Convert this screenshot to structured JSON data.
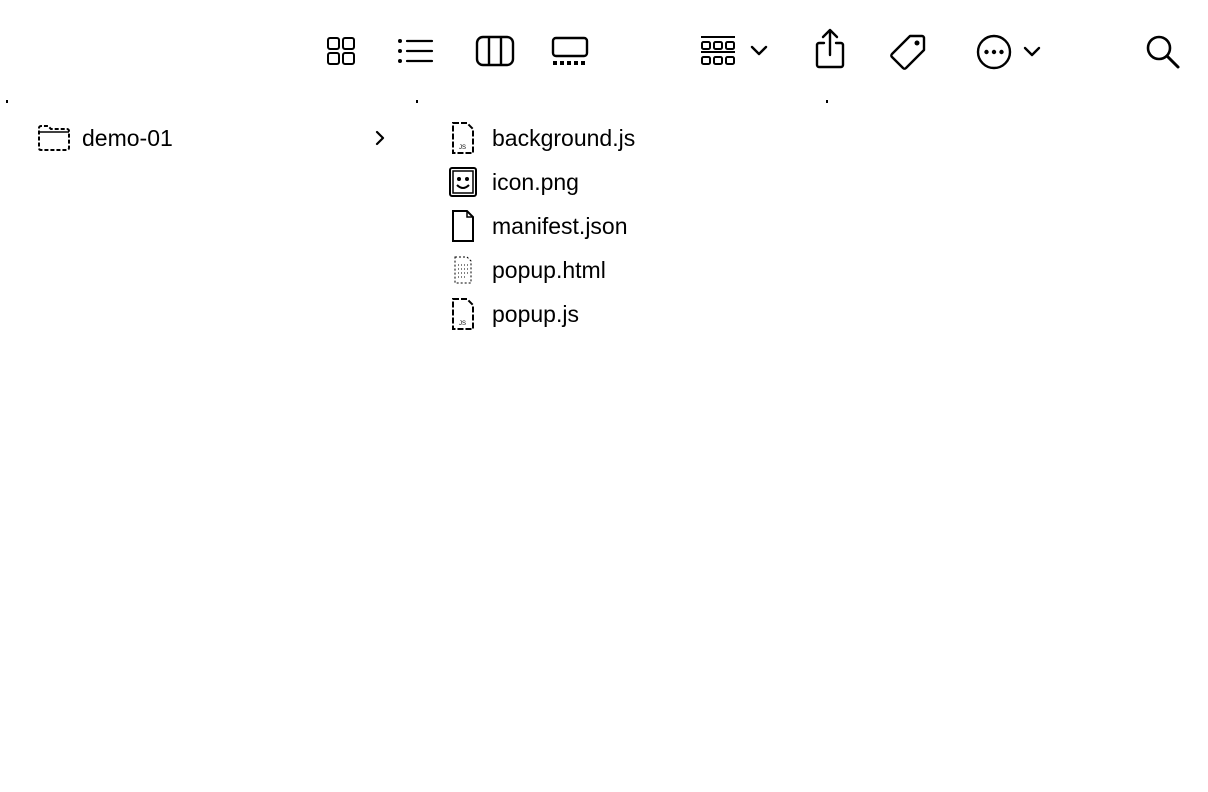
{
  "toolbar": {
    "buttons": [
      {
        "name": "icon-view-button",
        "icon": "grid-icon"
      },
      {
        "name": "list-view-button",
        "icon": "list-icon"
      },
      {
        "name": "column-view-button",
        "icon": "columns-icon"
      },
      {
        "name": "gallery-view-button",
        "icon": "gallery-icon"
      },
      {
        "name": "group-button",
        "icon": "group-icon"
      },
      {
        "name": "share-button",
        "icon": "share-icon"
      },
      {
        "name": "tag-button",
        "icon": "tag-icon"
      },
      {
        "name": "action-button",
        "icon": "ellipsis-circle-icon"
      },
      {
        "name": "search-button",
        "icon": "search-icon"
      }
    ]
  },
  "column1": {
    "items": [
      {
        "label": "demo-01",
        "icon": "folder-icon",
        "has_children": true
      }
    ]
  },
  "column2": {
    "items": [
      {
        "label": "background.js",
        "icon": "js-file-icon"
      },
      {
        "label": "icon.png",
        "icon": "image-file-icon"
      },
      {
        "label": "manifest.json",
        "icon": "generic-file-icon"
      },
      {
        "label": "popup.html",
        "icon": "html-file-icon"
      },
      {
        "label": "popup.js",
        "icon": "js-file-icon"
      }
    ]
  }
}
